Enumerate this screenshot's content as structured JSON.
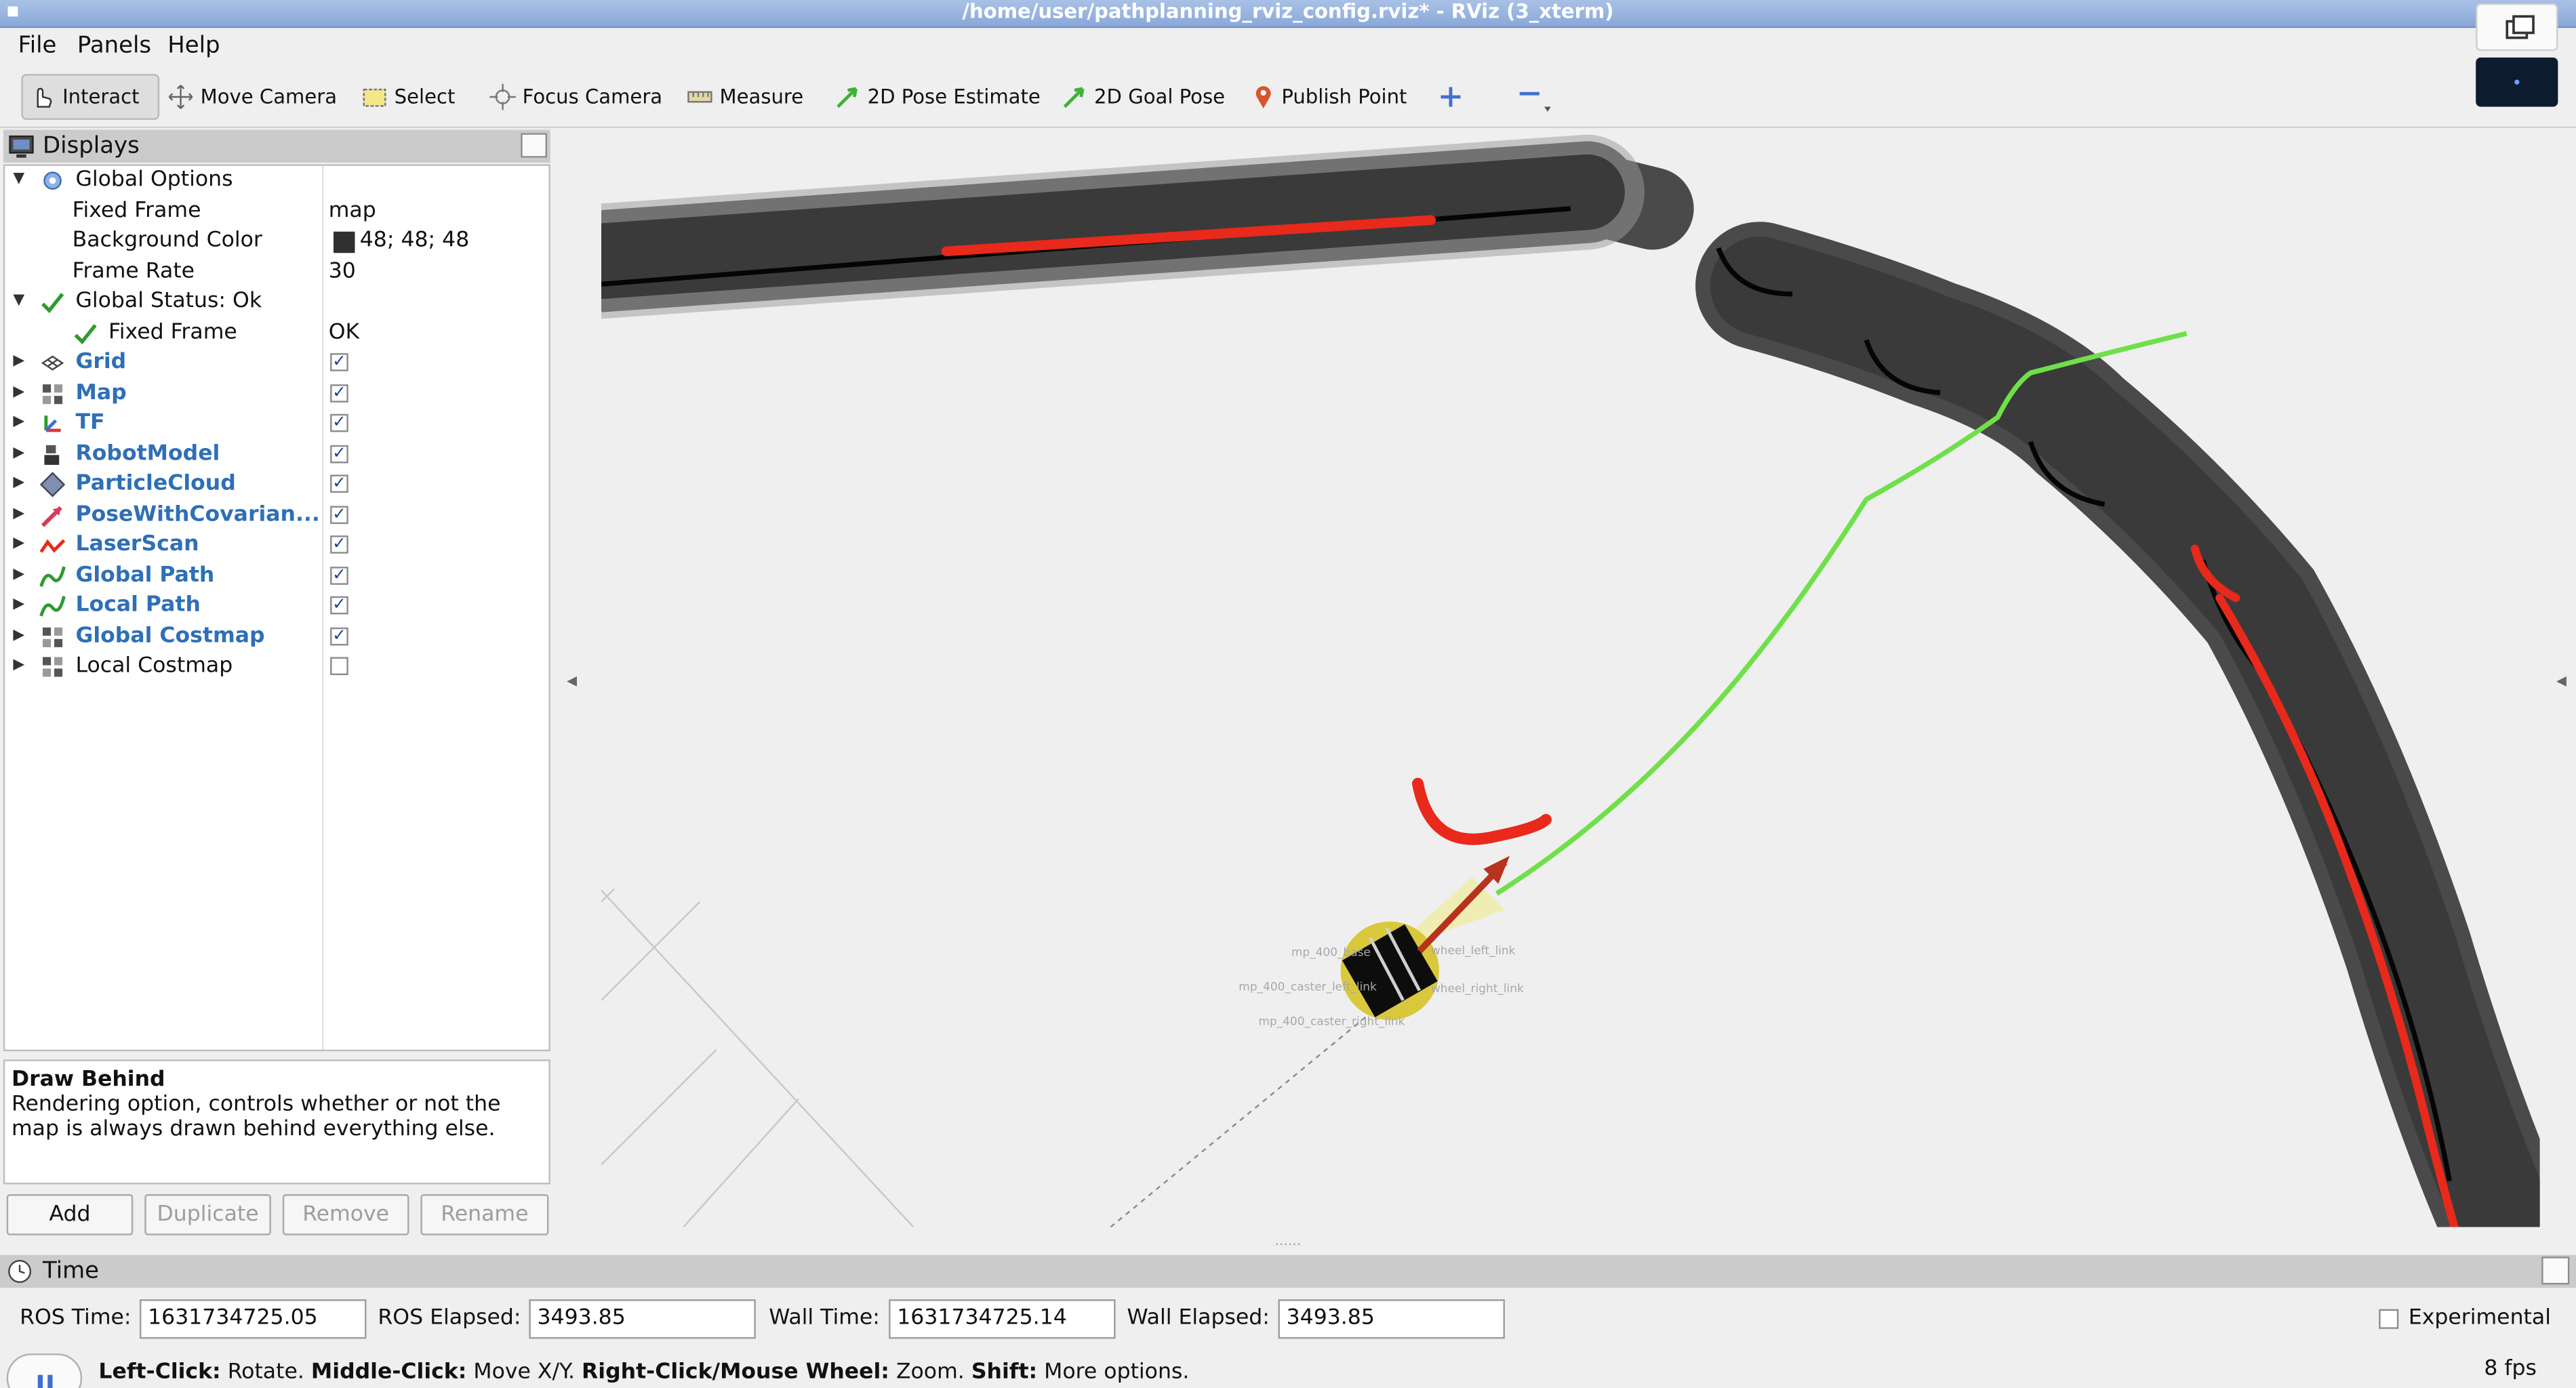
{
  "window": {
    "title": "/home/user/pathplanning_rviz_config.rviz* - RViz (3_xterm)"
  },
  "menu": {
    "file": "File",
    "panels": "Panels",
    "help": "Help"
  },
  "toolbar": {
    "interact": "Interact",
    "move_camera": "Move Camera",
    "select": "Select",
    "focus_camera": "Focus Camera",
    "measure": "Measure",
    "pose_estimate": "2D Pose Estimate",
    "goal_pose": "2D Goal Pose",
    "publish_point": "Publish Point"
  },
  "displays": {
    "title": "Displays",
    "global_options": {
      "label": "Global Options",
      "fixed_frame": {
        "label": "Fixed Frame",
        "value": "map"
      },
      "background_color": {
        "label": "Background Color",
        "value": "48; 48; 48",
        "swatch": "#303030"
      },
      "frame_rate": {
        "label": "Frame Rate",
        "value": "30"
      }
    },
    "global_status": {
      "label": "Global Status: Ok",
      "fixed_frame": {
        "label": "Fixed Frame",
        "value": "OK"
      }
    },
    "items": [
      {
        "label": "Grid",
        "checked": true
      },
      {
        "label": "Map",
        "checked": true
      },
      {
        "label": "TF",
        "checked": true
      },
      {
        "label": "RobotModel",
        "checked": true
      },
      {
        "label": "ParticleCloud",
        "checked": true
      },
      {
        "label": "PoseWithCovarian...",
        "checked": true
      },
      {
        "label": "LaserScan",
        "checked": true
      },
      {
        "label": "Global Path",
        "checked": true
      },
      {
        "label": "Local Path",
        "checked": true
      },
      {
        "label": "Global Costmap",
        "checked": true
      },
      {
        "label": "Local Costmap",
        "checked": false
      }
    ],
    "description": {
      "title": "Draw Behind",
      "text": "Rendering option, controls whether or not the map is always drawn behind everything else."
    },
    "buttons": {
      "add": "Add",
      "duplicate": "Duplicate",
      "remove": "Remove",
      "rename": "Rename"
    }
  },
  "time": {
    "title": "Time",
    "ros_time_label": "ROS Time:",
    "ros_time": "1631734725.05",
    "ros_elapsed_label": "ROS Elapsed:",
    "ros_elapsed": "3493.85",
    "wall_time_label": "Wall Time:",
    "wall_time": "1631734725.14",
    "wall_elapsed_label": "Wall Elapsed:",
    "wall_elapsed": "3493.85",
    "experimental": "Experimental"
  },
  "status": {
    "left_click": "Left-Click:",
    "left_click_action": "Rotate.",
    "middle_click": "Middle-Click:",
    "middle_click_action": "Move X/Y.",
    "right_click": "Right-Click/Mouse Wheel:",
    "right_click_action": "Zoom.",
    "shift": "Shift:",
    "shift_action": "More options.",
    "fps": "8 fps"
  },
  "colors": {
    "accent_blue": "#2f6fb6",
    "laser_red": "#e8291c",
    "path_green": "#6fe04a",
    "costmap_gray": "#474747"
  }
}
